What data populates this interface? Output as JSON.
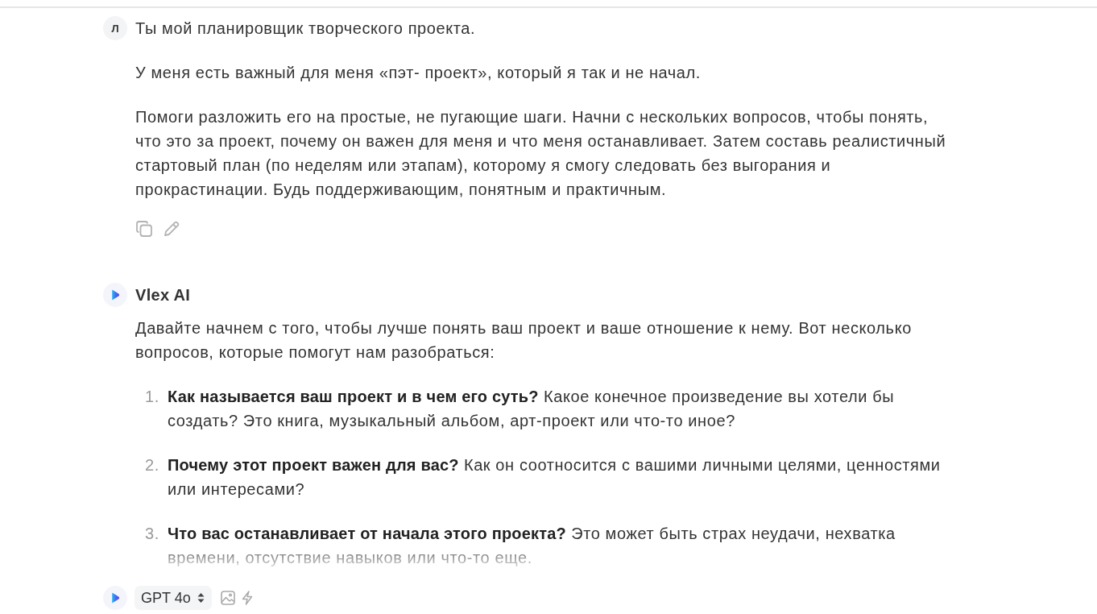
{
  "user_message": {
    "avatar": "Л",
    "paragraphs": [
      "Ты мой планировщик творческого проекта.",
      "У меня есть важный для меня «пэт- проект», который я так и не начал.",
      "Помоги разложить его на простые, не пугающие шаги. Начни с нескольких вопросов, чтобы понять, что это за проект, почему он важен для меня и что меня останавливает. Затем составь реалистичный стартовый план (по неделям или этапам), которому я смогу следовать без выгорания и прокрастинации. Будь поддерживающим, понятным и практичным."
    ]
  },
  "assistant_message": {
    "name": "Vlex AI",
    "intro": "Давайте начнем с того, чтобы лучше понять ваш проект и ваше отношение к нему. Вот несколько вопросов, которые помогут нам разобраться:",
    "questions": [
      {
        "number": "1.",
        "text": "**Как называется ваш проект и в чем его суть?** Какое конечное произведение вы хотели бы создать? Это книга, музыкальный альбом, арт-проект или что-то иное?"
      },
      {
        "number": "2.",
        "text": "**Почему этот проект важен для вас?** Как он соотносится с вашими личными целями, ценностями или интересами?"
      },
      {
        "number": "3.",
        "text": "**Что вас останавливает от начала этого проекта?** Это может быть страх неудачи, нехватка времени, отсутствие навыков или что-то еще."
      }
    ]
  },
  "composer": {
    "model": "GPT 4o"
  }
}
